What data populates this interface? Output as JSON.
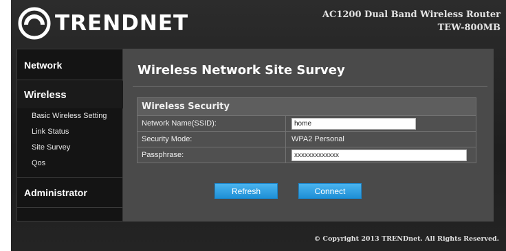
{
  "brand": {
    "name": "TRENDNET",
    "logo_icon": "trendnet-logo-icon"
  },
  "product": {
    "line1": "AC1200 Dual Band Wireless Router",
    "line2": "TEW-800MB"
  },
  "sidebar": {
    "network": "Network",
    "wireless": "Wireless",
    "items": [
      {
        "label": "Basic Wireless Setting"
      },
      {
        "label": "Link Status"
      },
      {
        "label": "Site Survey"
      },
      {
        "label": "Qos"
      }
    ],
    "administrator": "Administrator"
  },
  "main": {
    "title": "Wireless Network Site Survey",
    "section_title": "Wireless Security",
    "ssid_label": "Network Name(SSID):",
    "ssid_value": "home",
    "security_label": "Security Mode:",
    "security_value": "WPA2 Personal",
    "passphrase_label": "Passphrase:",
    "passphrase_value": "xxxxxxxxxxxxx",
    "refresh_label": "Refresh",
    "connect_label": "Connect"
  },
  "footer": {
    "copyright": "© Copyright 2013 TRENDnet. All Rights Reserved."
  },
  "colors": {
    "button": "#2a9be0",
    "panel": "#4a4a4a",
    "sidebar": "#141414"
  }
}
